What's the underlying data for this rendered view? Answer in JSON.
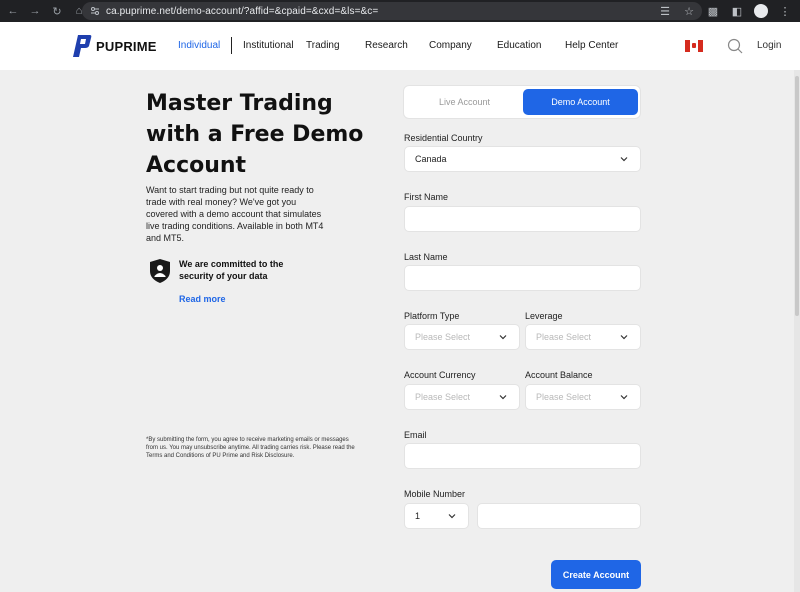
{
  "browser": {
    "url": "ca.puprime.net/demo-account/?affid=&cpaid=&cxd=&ls=&c="
  },
  "header": {
    "logo_text": "PUPRIME",
    "nav": [
      {
        "label": "Individual"
      },
      {
        "label": "Institutional"
      },
      {
        "label": "Trading"
      },
      {
        "label": "Research"
      },
      {
        "label": "Company"
      },
      {
        "label": "Education"
      },
      {
        "label": "Help Center"
      }
    ],
    "login_label": "Login",
    "accent_color": "#1f66e6"
  },
  "hero": {
    "title_line1": "Master Trading",
    "title_line2": "with a Free Demo",
    "title_line3": "Account",
    "description": "Want to start trading but not quite ready to trade with real money? We've got you covered with a demo account that simulates live trading conditions. Available in both MT4 and MT5.",
    "secure_text": "We are committed to the security of your data",
    "read_more": "Read more",
    "disclaimer": "*By submitting the form, you agree to receive marketing emails or messages from us. You may unsubscribe anytime. All trading carries risk. Please read the Terms and Conditions of PU Prime and Risk Disclosure."
  },
  "form": {
    "tabs": {
      "live": "Live Account",
      "demo": "Demo Account"
    },
    "residential_country_label": "Residential Country",
    "residential_country_value": "Canada",
    "first_name_label": "First Name",
    "last_name_label": "Last Name",
    "platform_type_label": "Platform Type",
    "platform_type_placeholder": "Please Select",
    "leverage_label": "Leverage",
    "leverage_placeholder": "Please Select",
    "account_currency_label": "Account Currency",
    "account_currency_placeholder": "Please Select",
    "account_balance_label": "Account Balance",
    "account_balance_placeholder": "Please Select",
    "email_label": "Email",
    "mobile_number_label": "Mobile Number",
    "mobile_code_value": "1",
    "create_button": "Create Account"
  }
}
